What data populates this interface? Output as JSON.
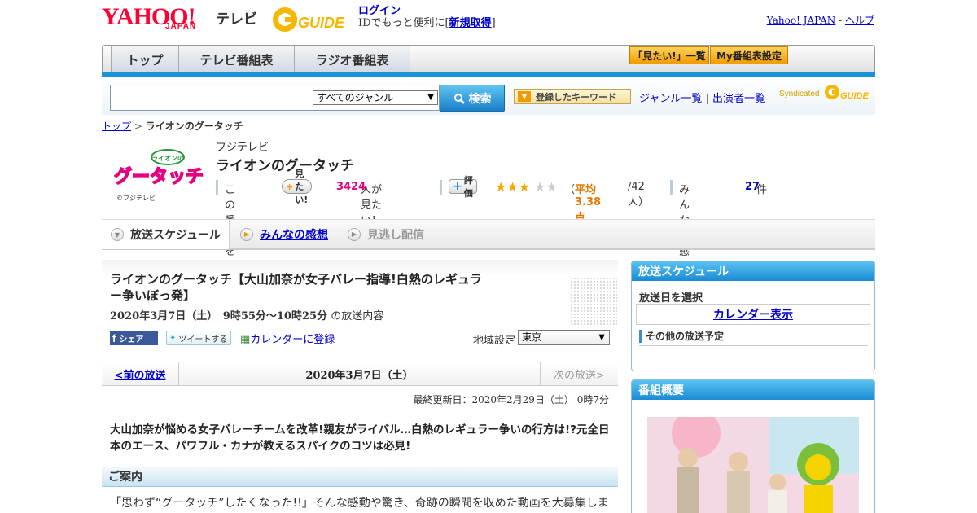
{
  "header": {
    "yahoo_logo": "YAHOO!",
    "japan_logo": "JAPAN",
    "tv_label": "テレビ",
    "gguide_logo": "GUIDE",
    "login_label": "ログイン",
    "id_prefix": "IDでもっと便利に[",
    "signup_label": "新規取得",
    "id_suffix": "]",
    "yahoo_japan_link": "Yahoo! JAPAN",
    "separator": " - ",
    "help_link": "ヘルプ"
  },
  "nav": {
    "tabs": [
      {
        "label": "トップ"
      },
      {
        "label": "テレビ番組表"
      },
      {
        "label": "ラジオ番組表"
      }
    ],
    "mitai_list_label": "「見たい!」一覧",
    "my_schedule_label": "My番組表設定"
  },
  "search": {
    "placeholder": "",
    "genre_selected": "すべてのジャンル",
    "search_button": "検索",
    "keyword_button": "登録したキーワード",
    "genre_list_link": "ジャンル一覧",
    "divider": "|",
    "performer_list_link": "出演者一覧",
    "syndicated": "Syndicated"
  },
  "breadcrumb": {
    "top": "トップ",
    "sep": " > ",
    "current": "ライオンのグータッチ"
  },
  "program": {
    "logo_text": "グータッチ",
    "logo_small": "ライオンの",
    "copyright": "©フジテレビ",
    "channel": "フジテレビ",
    "title": "ライオンのグータッチ",
    "stat_prefix": "この番組を",
    "mitai_pill": "見たい!",
    "mitai_count": "3424",
    "mitai_suffix": "人が見たい！",
    "rating_pill": "評価",
    "rating_value": 3.38,
    "stars_filled": "★★★",
    "stars_empty": "★★",
    "rating_open": "（",
    "rating_text": "平均3.38点",
    "rating_count": "/42人）",
    "review_prefix": "みんなの感想",
    "review_count": "27",
    "review_suffix": "件"
  },
  "tabs": {
    "schedule": "放送スケジュール",
    "reviews": "みんなの感想",
    "missed": "見逃し配信"
  },
  "episode": {
    "title": "ライオンのグータッチ【大山加奈が女子バレー指導!白熱のレギュラー争いぼっ発】",
    "date": "2020年3月7日（土）　9時55分～10時25分",
    "date_suffix": "の放送内容",
    "fb_label": "シェア",
    "tw_label": "ツイートする",
    "calendar_link": "カレンダーに登録",
    "region_label": "地域設定",
    "region_selected": "東京",
    "prev_link": "<前の放送",
    "current_date": "2020年3月7日（土）",
    "next_link": "次の放送>",
    "updated": "最終更新日：2020年2月29日（土）  0時7分",
    "summary": "大山加奈が悩める女子バレーチームを改革!親友がライバル…白熱のレギュラー争いの行方は!?元全日本のエース、パワフル・カナが教えるスパイクのコツは必見!",
    "guide_heading": "ご案内",
    "guide_text": "「思わず“グータッチ”したくなった!!」そんな感動や驚き、奇跡の瞬間を収めた動画を大募集しま"
  },
  "sidebar": {
    "schedule_heading": "放送スケジュール",
    "select_date": "放送日を選択",
    "calendar_button": "カレンダー表示",
    "other_schedule": "その他の放送予定",
    "overview_heading": "番組概要"
  },
  "colors": {
    "accent_blue": "#1a94d8",
    "yahoo_red": "#ff0033",
    "rating_orange": "#e07b00",
    "count_pink": "#e4007f"
  }
}
